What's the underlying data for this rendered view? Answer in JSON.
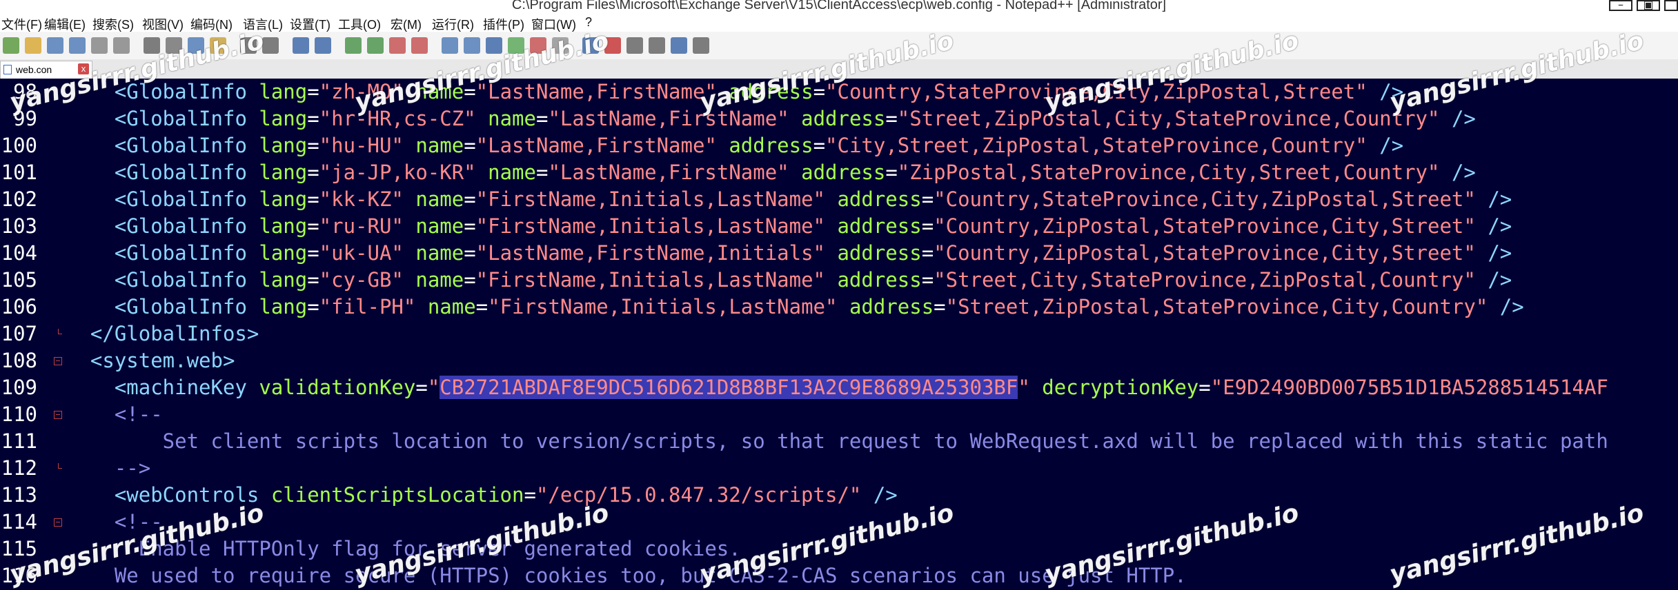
{
  "window": {
    "title": "C:\\Program Files\\Microsoft\\Exchange Server\\V15\\ClientAccess\\ecp\\web.config - Notepad++ [Administrator]",
    "controls": [
      "minimize-icon",
      "maximize-icon"
    ]
  },
  "menu": {
    "items": [
      "文件(F)",
      "编辑(E)",
      "搜索(S)",
      "视图(V)",
      "编码(N)",
      "语言(L)",
      "设置(T)",
      "工具(O)",
      "宏(M)",
      "运行(R)",
      "插件(P)",
      "窗口(W)",
      "?"
    ]
  },
  "toolbar": {
    "icons": [
      "new-file-icon",
      "open-file-icon",
      "save-icon",
      "save-all-icon",
      "close-icon",
      "close-all-icon",
      "print-icon",
      "cut-icon",
      "copy-icon",
      "paste-icon",
      "undo-icon",
      "redo-icon",
      "find-icon",
      "replace-icon",
      "zoom-in-icon",
      "zoom-out-icon",
      "sync-v-icon",
      "sync-h-icon",
      "word-wrap-icon",
      "show-all-icon",
      "indent-guide-icon",
      "lang-icon",
      "doc-map-icon",
      "function-list-icon",
      "monitor-icon",
      "record-icon",
      "stop-icon",
      "play-icon",
      "run-multi-icon",
      "save-macro-icon"
    ]
  },
  "tab": {
    "label": "web.con",
    "close_label": "x"
  },
  "editor": {
    "colors": {
      "background": "#000033",
      "tag": "#8dd6ff",
      "attribute": "#a6ff4d",
      "value": "#ff8a8a",
      "comment": "#8a8ae6",
      "selection": "#3a3ab4"
    },
    "lines": [
      {
        "n": "98",
        "fold": "",
        "parts": [
          [
            "plain",
            "    "
          ],
          [
            "tag",
            "<GlobalInfo "
          ],
          [
            "attr",
            "lang"
          ],
          [
            "eq",
            "="
          ],
          [
            "val",
            "\"zh-MO\""
          ],
          [
            "plain",
            " "
          ],
          [
            "attr",
            "name"
          ],
          [
            "eq",
            "="
          ],
          [
            "val",
            "\"LastName,FirstName\""
          ],
          [
            "plain",
            " "
          ],
          [
            "attr",
            "address"
          ],
          [
            "eq",
            "="
          ],
          [
            "val",
            "\"Country,StateProvince,City,ZipPostal,Street\""
          ],
          [
            "plain",
            " "
          ],
          [
            "tag",
            "/>"
          ]
        ]
      },
      {
        "n": "99",
        "fold": "",
        "parts": [
          [
            "plain",
            "    "
          ],
          [
            "tag",
            "<GlobalInfo "
          ],
          [
            "attr",
            "lang"
          ],
          [
            "eq",
            "="
          ],
          [
            "val",
            "\"hr-HR,cs-CZ\""
          ],
          [
            "plain",
            " "
          ],
          [
            "attr",
            "name"
          ],
          [
            "eq",
            "="
          ],
          [
            "val",
            "\"LastName,FirstName\""
          ],
          [
            "plain",
            " "
          ],
          [
            "attr",
            "address"
          ],
          [
            "eq",
            "="
          ],
          [
            "val",
            "\"Street,ZipPostal,City,StateProvince,Country\""
          ],
          [
            "plain",
            " "
          ],
          [
            "tag",
            "/>"
          ]
        ]
      },
      {
        "n": "100",
        "fold": "",
        "parts": [
          [
            "plain",
            "    "
          ],
          [
            "tag",
            "<GlobalInfo "
          ],
          [
            "attr",
            "lang"
          ],
          [
            "eq",
            "="
          ],
          [
            "val",
            "\"hu-HU\""
          ],
          [
            "plain",
            " "
          ],
          [
            "attr",
            "name"
          ],
          [
            "eq",
            "="
          ],
          [
            "val",
            "\"LastName,FirstName\""
          ],
          [
            "plain",
            " "
          ],
          [
            "attr",
            "address"
          ],
          [
            "eq",
            "="
          ],
          [
            "val",
            "\"City,Street,ZipPostal,StateProvince,Country\""
          ],
          [
            "plain",
            " "
          ],
          [
            "tag",
            "/>"
          ]
        ]
      },
      {
        "n": "101",
        "fold": "",
        "parts": [
          [
            "plain",
            "    "
          ],
          [
            "tag",
            "<GlobalInfo "
          ],
          [
            "attr",
            "lang"
          ],
          [
            "eq",
            "="
          ],
          [
            "val",
            "\"ja-JP,ko-KR\""
          ],
          [
            "plain",
            " "
          ],
          [
            "attr",
            "name"
          ],
          [
            "eq",
            "="
          ],
          [
            "val",
            "\"LastName,FirstName\""
          ],
          [
            "plain",
            " "
          ],
          [
            "attr",
            "address"
          ],
          [
            "eq",
            "="
          ],
          [
            "val",
            "\"ZipPostal,StateProvince,City,Street,Country\""
          ],
          [
            "plain",
            " "
          ],
          [
            "tag",
            "/>"
          ]
        ]
      },
      {
        "n": "102",
        "fold": "",
        "parts": [
          [
            "plain",
            "    "
          ],
          [
            "tag",
            "<GlobalInfo "
          ],
          [
            "attr",
            "lang"
          ],
          [
            "eq",
            "="
          ],
          [
            "val",
            "\"kk-KZ\""
          ],
          [
            "plain",
            " "
          ],
          [
            "attr",
            "name"
          ],
          [
            "eq",
            "="
          ],
          [
            "val",
            "\"FirstName,Initials,LastName\""
          ],
          [
            "plain",
            " "
          ],
          [
            "attr",
            "address"
          ],
          [
            "eq",
            "="
          ],
          [
            "val",
            "\"Country,StateProvince,City,ZipPostal,Street\""
          ],
          [
            "plain",
            " "
          ],
          [
            "tag",
            "/>"
          ]
        ]
      },
      {
        "n": "103",
        "fold": "",
        "parts": [
          [
            "plain",
            "    "
          ],
          [
            "tag",
            "<GlobalInfo "
          ],
          [
            "attr",
            "lang"
          ],
          [
            "eq",
            "="
          ],
          [
            "val",
            "\"ru-RU\""
          ],
          [
            "plain",
            " "
          ],
          [
            "attr",
            "name"
          ],
          [
            "eq",
            "="
          ],
          [
            "val",
            "\"FirstName,Initials,LastName\""
          ],
          [
            "plain",
            " "
          ],
          [
            "attr",
            "address"
          ],
          [
            "eq",
            "="
          ],
          [
            "val",
            "\"Country,ZipPostal,StateProvince,City,Street\""
          ],
          [
            "plain",
            " "
          ],
          [
            "tag",
            "/>"
          ]
        ]
      },
      {
        "n": "104",
        "fold": "",
        "parts": [
          [
            "plain",
            "    "
          ],
          [
            "tag",
            "<GlobalInfo "
          ],
          [
            "attr",
            "lang"
          ],
          [
            "eq",
            "="
          ],
          [
            "val",
            "\"uk-UA\""
          ],
          [
            "plain",
            " "
          ],
          [
            "attr",
            "name"
          ],
          [
            "eq",
            "="
          ],
          [
            "val",
            "\"LastName,FirstName,Initials\""
          ],
          [
            "plain",
            " "
          ],
          [
            "attr",
            "address"
          ],
          [
            "eq",
            "="
          ],
          [
            "val",
            "\"Country,ZipPostal,StateProvince,City,Street\""
          ],
          [
            "plain",
            " "
          ],
          [
            "tag",
            "/>"
          ]
        ]
      },
      {
        "n": "105",
        "fold": "",
        "parts": [
          [
            "plain",
            "    "
          ],
          [
            "tag",
            "<GlobalInfo "
          ],
          [
            "attr",
            "lang"
          ],
          [
            "eq",
            "="
          ],
          [
            "val",
            "\"cy-GB\""
          ],
          [
            "plain",
            " "
          ],
          [
            "attr",
            "name"
          ],
          [
            "eq",
            "="
          ],
          [
            "val",
            "\"FirstName,Initials,LastName\""
          ],
          [
            "plain",
            " "
          ],
          [
            "attr",
            "address"
          ],
          [
            "eq",
            "="
          ],
          [
            "val",
            "\"Street,City,StateProvince,ZipPostal,Country\""
          ],
          [
            "plain",
            " "
          ],
          [
            "tag",
            "/>"
          ]
        ]
      },
      {
        "n": "106",
        "fold": "",
        "parts": [
          [
            "plain",
            "    "
          ],
          [
            "tag",
            "<GlobalInfo "
          ],
          [
            "attr",
            "lang"
          ],
          [
            "eq",
            "="
          ],
          [
            "val",
            "\"fil-PH\""
          ],
          [
            "plain",
            " "
          ],
          [
            "attr",
            "name"
          ],
          [
            "eq",
            "="
          ],
          [
            "val",
            "\"FirstName,Initials,LastName\""
          ],
          [
            "plain",
            " "
          ],
          [
            "attr",
            "address"
          ],
          [
            "eq",
            "="
          ],
          [
            "val",
            "\"Street,ZipPostal,StateProvince,City,Country\""
          ],
          [
            "plain",
            " "
          ],
          [
            "tag",
            "/>"
          ]
        ]
      },
      {
        "n": "107",
        "fold": "end",
        "parts": [
          [
            "plain",
            "  "
          ],
          [
            "tag",
            "</GlobalInfos>"
          ]
        ]
      },
      {
        "n": "108",
        "fold": "box",
        "parts": [
          [
            "plain",
            "  "
          ],
          [
            "tag",
            "<system.web>"
          ]
        ]
      },
      {
        "n": "109",
        "fold": "",
        "parts": [
          [
            "plain",
            "    "
          ],
          [
            "tag",
            "<machineKey "
          ],
          [
            "attr",
            "validationKey"
          ],
          [
            "eq",
            "="
          ],
          [
            "val",
            "\""
          ],
          [
            "sel",
            "CB2721ABDAF8E9DC516D621D8B8BF13A2C9E8689A25303BF"
          ],
          [
            "val",
            "\""
          ],
          [
            "plain",
            " "
          ],
          [
            "attr",
            "decryptionKey"
          ],
          [
            "eq",
            "="
          ],
          [
            "val",
            "\"E9D2490BD0075B51D1BA5288514514AF"
          ]
        ]
      },
      {
        "n": "110",
        "fold": "box",
        "parts": [
          [
            "plain",
            "    "
          ],
          [
            "cmt",
            "<!--"
          ]
        ]
      },
      {
        "n": "111",
        "fold": "",
        "parts": [
          [
            "cmt",
            "        Set client scripts location to version/scripts, so that request to WebRequest.axd will be replaced with this static path"
          ]
        ]
      },
      {
        "n": "112",
        "fold": "end",
        "parts": [
          [
            "plain",
            "    "
          ],
          [
            "cmt",
            "-->"
          ]
        ]
      },
      {
        "n": "113",
        "fold": "",
        "parts": [
          [
            "plain",
            "    "
          ],
          [
            "tag",
            "<webControls "
          ],
          [
            "attr",
            "clientScriptsLocation"
          ],
          [
            "eq",
            "="
          ],
          [
            "val",
            "\"/ecp/15.0.847.32/scripts/\""
          ],
          [
            "plain",
            " "
          ],
          [
            "tag",
            "/>"
          ]
        ]
      },
      {
        "n": "114",
        "fold": "box",
        "parts": [
          [
            "plain",
            "    "
          ],
          [
            "cmt",
            "<!--"
          ]
        ]
      },
      {
        "n": "115",
        "fold": "",
        "parts": [
          [
            "cmt",
            "      Enable HTTPOnly flag for server generated cookies."
          ]
        ]
      },
      {
        "n": "116",
        "fold": "",
        "parts": [
          [
            "cmt",
            "    We used to require secure (HTTPS) cookies too, but CAS-2-CAS scenarios can use just HTTP."
          ]
        ]
      }
    ]
  },
  "watermark": {
    "text": "yangsirrr.github.io"
  }
}
